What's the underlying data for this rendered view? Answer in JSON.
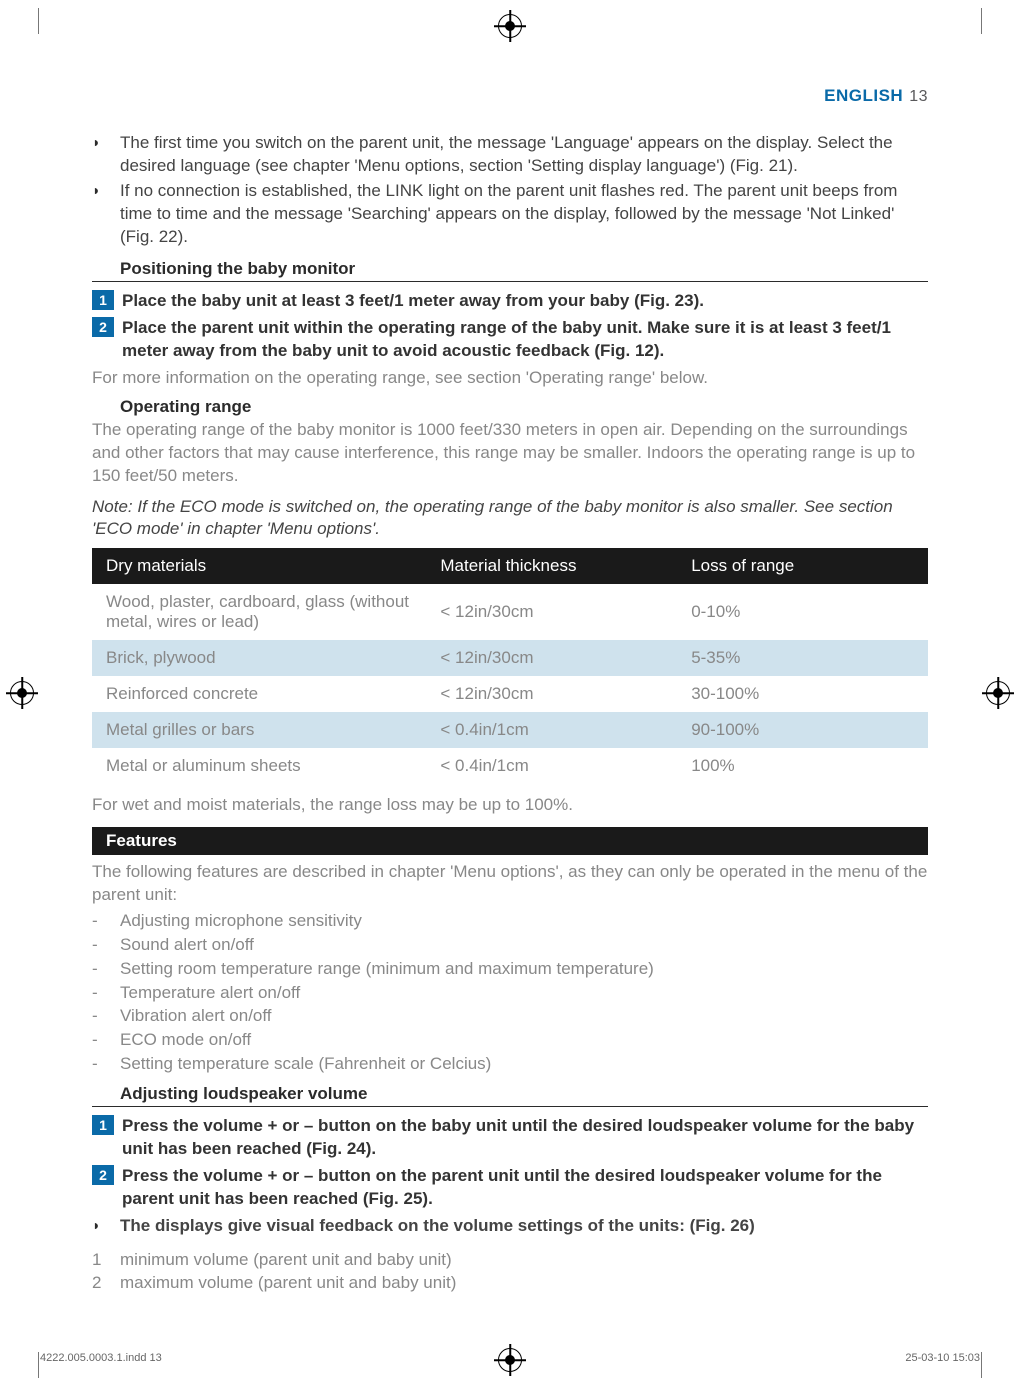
{
  "header": {
    "lang": "ENGLISH",
    "page": "13"
  },
  "intro_bullets": [
    "The first time you switch on the parent unit, the message 'Language' appears on the display. Select the desired language (see chapter 'Menu options, section 'Setting display language') (Fig. 21).",
    "If no connection is established, the LINK light on the parent unit flashes red. The parent unit beeps from time to time and the message 'Searching' appears on the display, followed by the message 'Not Linked' (Fig. 22)."
  ],
  "positioning": {
    "heading": "Positioning the baby monitor",
    "steps": [
      "Place the baby unit at least 3 feet/1 meter away from your baby (Fig. 23).",
      "Place the parent unit within the operating range of the baby unit. Make sure it is at least 3 feet/1 meter away from the baby unit to avoid acoustic feedback (Fig. 12)."
    ],
    "after": "For more information on the operating range, see section 'Operating range' below."
  },
  "operating_range": {
    "heading": "Operating range",
    "para": "The operating range of the baby monitor is 1000 feet/330 meters in open air. Depending on the surroundings and other factors that may cause interference, this range may be smaller. Indoors the operating range is up to 150 feet/50 meters.",
    "note": "Note: If the ECO mode is switched on, the operating range of the baby monitor is also smaller. See section 'ECO mode' in chapter 'Menu options'."
  },
  "table": {
    "headers": [
      "Dry materials",
      "Material thickness",
      "Loss of range"
    ],
    "rows": [
      {
        "c1": "Wood, plaster, cardboard, glass (without metal, wires or lead)",
        "c2": "< 12in/30cm",
        "c3": "0-10%",
        "alt": false
      },
      {
        "c1": "Brick, plywood",
        "c2": "< 12in/30cm",
        "c3": "5-35%",
        "alt": true
      },
      {
        "c1": "Reinforced concrete",
        "c2": "< 12in/30cm",
        "c3": "30-100%",
        "alt": false
      },
      {
        "c1": "Metal grilles or bars",
        "c2": "< 0.4in/1cm",
        "c3": "90-100%",
        "alt": true
      },
      {
        "c1": "Metal or aluminum sheets",
        "c2": "< 0.4in/1cm",
        "c3": "100%",
        "alt": false
      }
    ],
    "after": "For wet and moist materials, the range loss may be up to 100%."
  },
  "features": {
    "title": "Features",
    "intro": "The following features are described in chapter 'Menu options', as they can only be operated in the menu of the parent unit:",
    "items": [
      "Adjusting microphone sensitivity",
      "Sound alert on/off",
      "Setting room temperature range (minimum and maximum temperature)",
      "Temperature alert on/off",
      "Vibration alert on/off",
      "ECO mode on/off",
      "Setting temperature scale (Fahrenheit or Celcius)"
    ]
  },
  "volume": {
    "heading": "Adjusting loudspeaker volume",
    "steps": [
      "Press the volume + or – button on the baby unit until the desired loudspeaker volume for the baby unit has been reached (Fig. 24).",
      "Press the volume + or – button on the parent unit until the desired loudspeaker volume for the parent unit has been reached (Fig. 25)."
    ],
    "bullet": "The displays give visual feedback on the volume settings of the units: (Fig. 26)",
    "numbered": [
      "minimum volume (parent unit and baby unit)",
      "maximum volume (parent unit and baby unit)"
    ]
  },
  "footer": {
    "left": "4222.005.0003.1.indd   13",
    "right": "25-03-10   15:03"
  }
}
